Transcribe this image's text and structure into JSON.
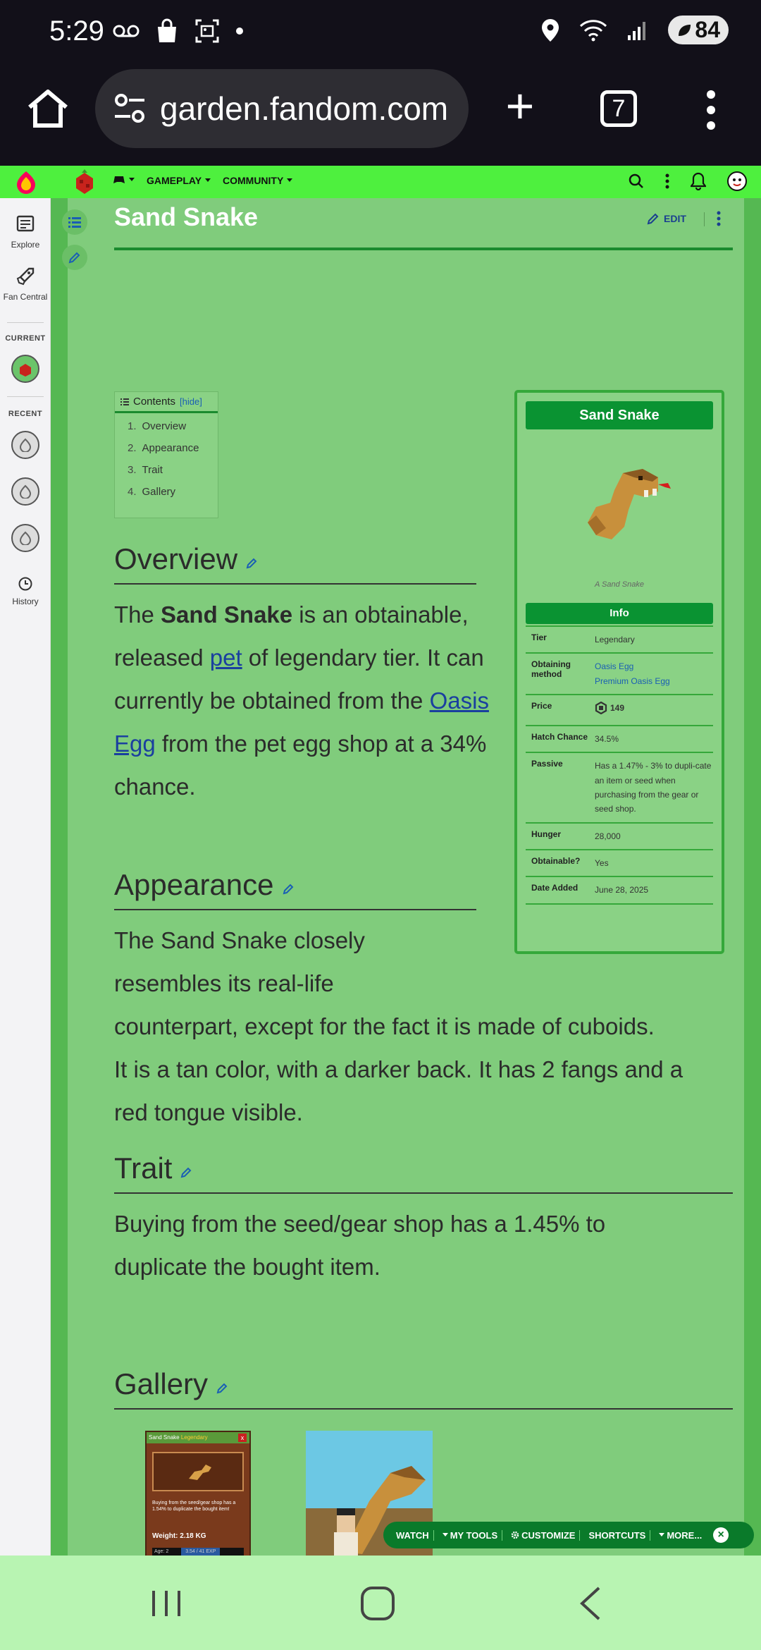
{
  "status": {
    "time": "5:29",
    "battery": "84"
  },
  "browser": {
    "url": "garden.fandom.com",
    "tab_count": "7"
  },
  "fandom_nav": {
    "gameplay": "GAMEPLAY",
    "community": "COMMUNITY"
  },
  "rail": {
    "explore": "Explore",
    "fan_central": "Fan Central",
    "current": "CURRENT",
    "recent": "RECENT",
    "history": "History"
  },
  "article": {
    "title": "Sand Snake",
    "edit": "EDIT",
    "toc": {
      "title": "Contents",
      "hide": "[hide]",
      "items": [
        {
          "n": "1.",
          "label": "Overview"
        },
        {
          "n": "2.",
          "label": "Appearance"
        },
        {
          "n": "3.",
          "label": "Trait"
        },
        {
          "n": "4.",
          "label": "Gallery"
        }
      ]
    },
    "sections": {
      "overview": "Overview",
      "appearance": "Appearance",
      "trait": "Trait",
      "gallery": "Gallery"
    },
    "overview_text": {
      "p1": "The ",
      "bold": "Sand Snake",
      "p2": " is an obtainable, released ",
      "link_pet": "pet",
      "p3": " of legendary tier. It can currently be obtained from the ",
      "link_egg": "Oasis Egg",
      "p4": " from the pet egg shop at a 34% chance."
    },
    "appearance_text": {
      "line1": "The Sand Snake closely",
      "line2": "resembles its real-life",
      "line3": "counterpart, except for the fact it is made of cuboids.",
      "line4": "It is a tan color, with a darker back. It has 2 fangs and a",
      "line5": "red tongue visible."
    },
    "trait_text": {
      "line1": "Buying from the seed/gear shop has a 1.45% to",
      "line2": "duplicate the bought item."
    }
  },
  "infobox": {
    "title": "Sand Snake",
    "caption": "A Sand Snake",
    "info_header": "Info",
    "rows": [
      {
        "k": "Tier",
        "v": "Legendary"
      },
      {
        "k": "Obtaining method",
        "links": [
          "Oasis Egg",
          "Premium Oasis Egg"
        ]
      },
      {
        "k": "Price",
        "v": "149"
      },
      {
        "k": "Hatch Chance",
        "v": "34.5%"
      },
      {
        "k": "Passive",
        "v": "Has a 1.47% - 3% to dupli-cate an item or seed when purchasing from the gear or seed shop."
      },
      {
        "k": "Hunger",
        "v": "28,000"
      },
      {
        "k": "Obtainable?",
        "v": "Yes"
      },
      {
        "k": "Date Added",
        "v": "June 28, 2025"
      }
    ]
  },
  "gallery": {
    "card_title": "Sand Snake",
    "card_rarity": "Legendary",
    "card_text": "Buying from the seed/gear shop has a 1.54% to duplicate the bought item!",
    "card_weight": "Weight: 2.18 KG",
    "card_age": "Age: 2",
    "card_exp": "3.54 / 41 EXP"
  },
  "toolbar": {
    "watch": "WATCH",
    "my_tools": "MY TOOLS",
    "customize": "CUSTOMIZE",
    "shortcuts": "SHORTCUTS",
    "more": "MORE..."
  },
  "colors": {
    "fandom_nav": "#4ef03e",
    "page_bg": "#80cc7c",
    "accent_green": "#0a9332",
    "link": "#1a3f9f"
  }
}
